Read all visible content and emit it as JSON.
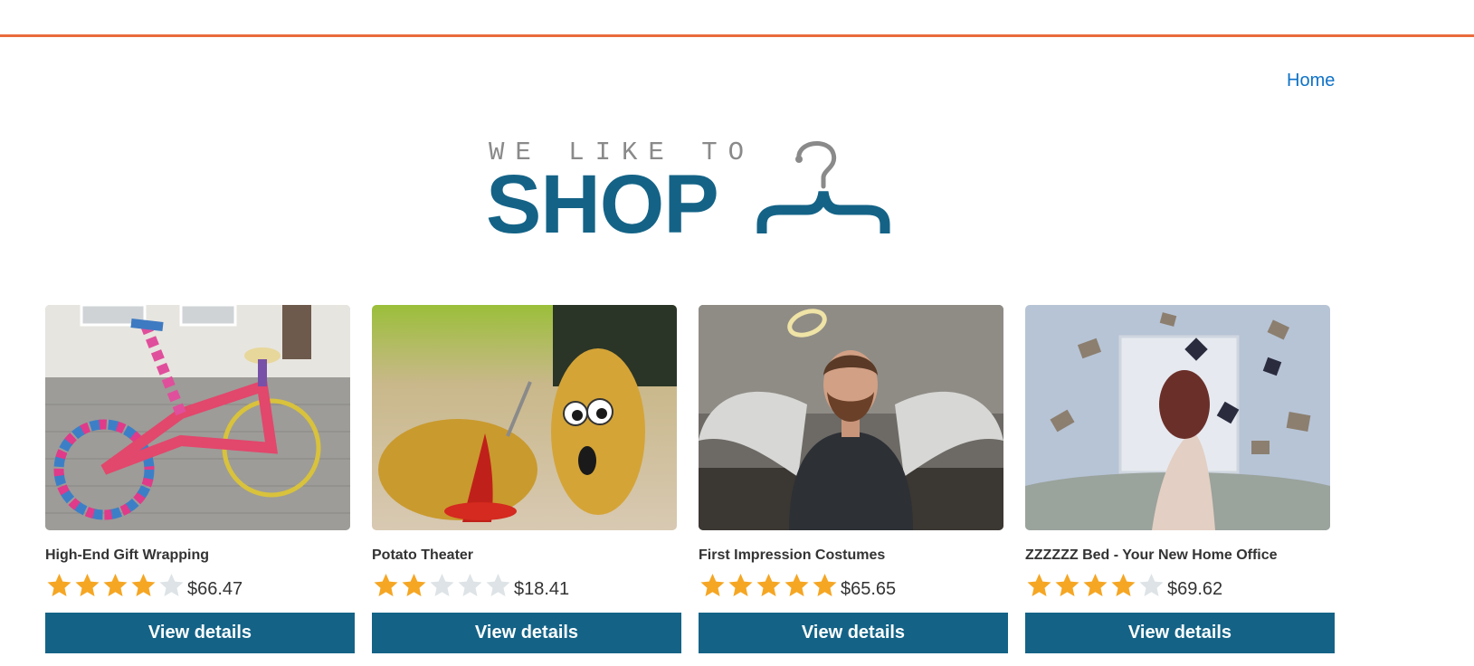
{
  "nav": {
    "home_label": "Home"
  },
  "logo": {
    "tagline": "WE LIKE TO",
    "word": "SHOP",
    "icon": "hanger-icon"
  },
  "colors": {
    "accent_rule": "#ea6b3c",
    "brand": "#146387",
    "star_filled": "#f5a623",
    "star_empty": "#dde3e6",
    "link": "#0f72c7"
  },
  "products": [
    {
      "title": "High-End Gift Wrapping",
      "rating": 4,
      "max_rating": 5,
      "price": "$66.47",
      "button_label": "View details",
      "image": "knitted-bicycle-image"
    },
    {
      "title": "Potato Theater",
      "rating": 2,
      "max_rating": 5,
      "price": "$18.41",
      "button_label": "View details",
      "image": "potatoes-image"
    },
    {
      "title": "First Impression Costumes",
      "rating": 5,
      "max_rating": 5,
      "price": "$65.65",
      "button_label": "View details",
      "image": "angel-man-image"
    },
    {
      "title": "ZZZZZZ Bed - Your New Home Office",
      "rating": 4,
      "max_rating": 5,
      "price": "$69.62",
      "button_label": "View details",
      "image": "flying-books-bed-image"
    }
  ]
}
